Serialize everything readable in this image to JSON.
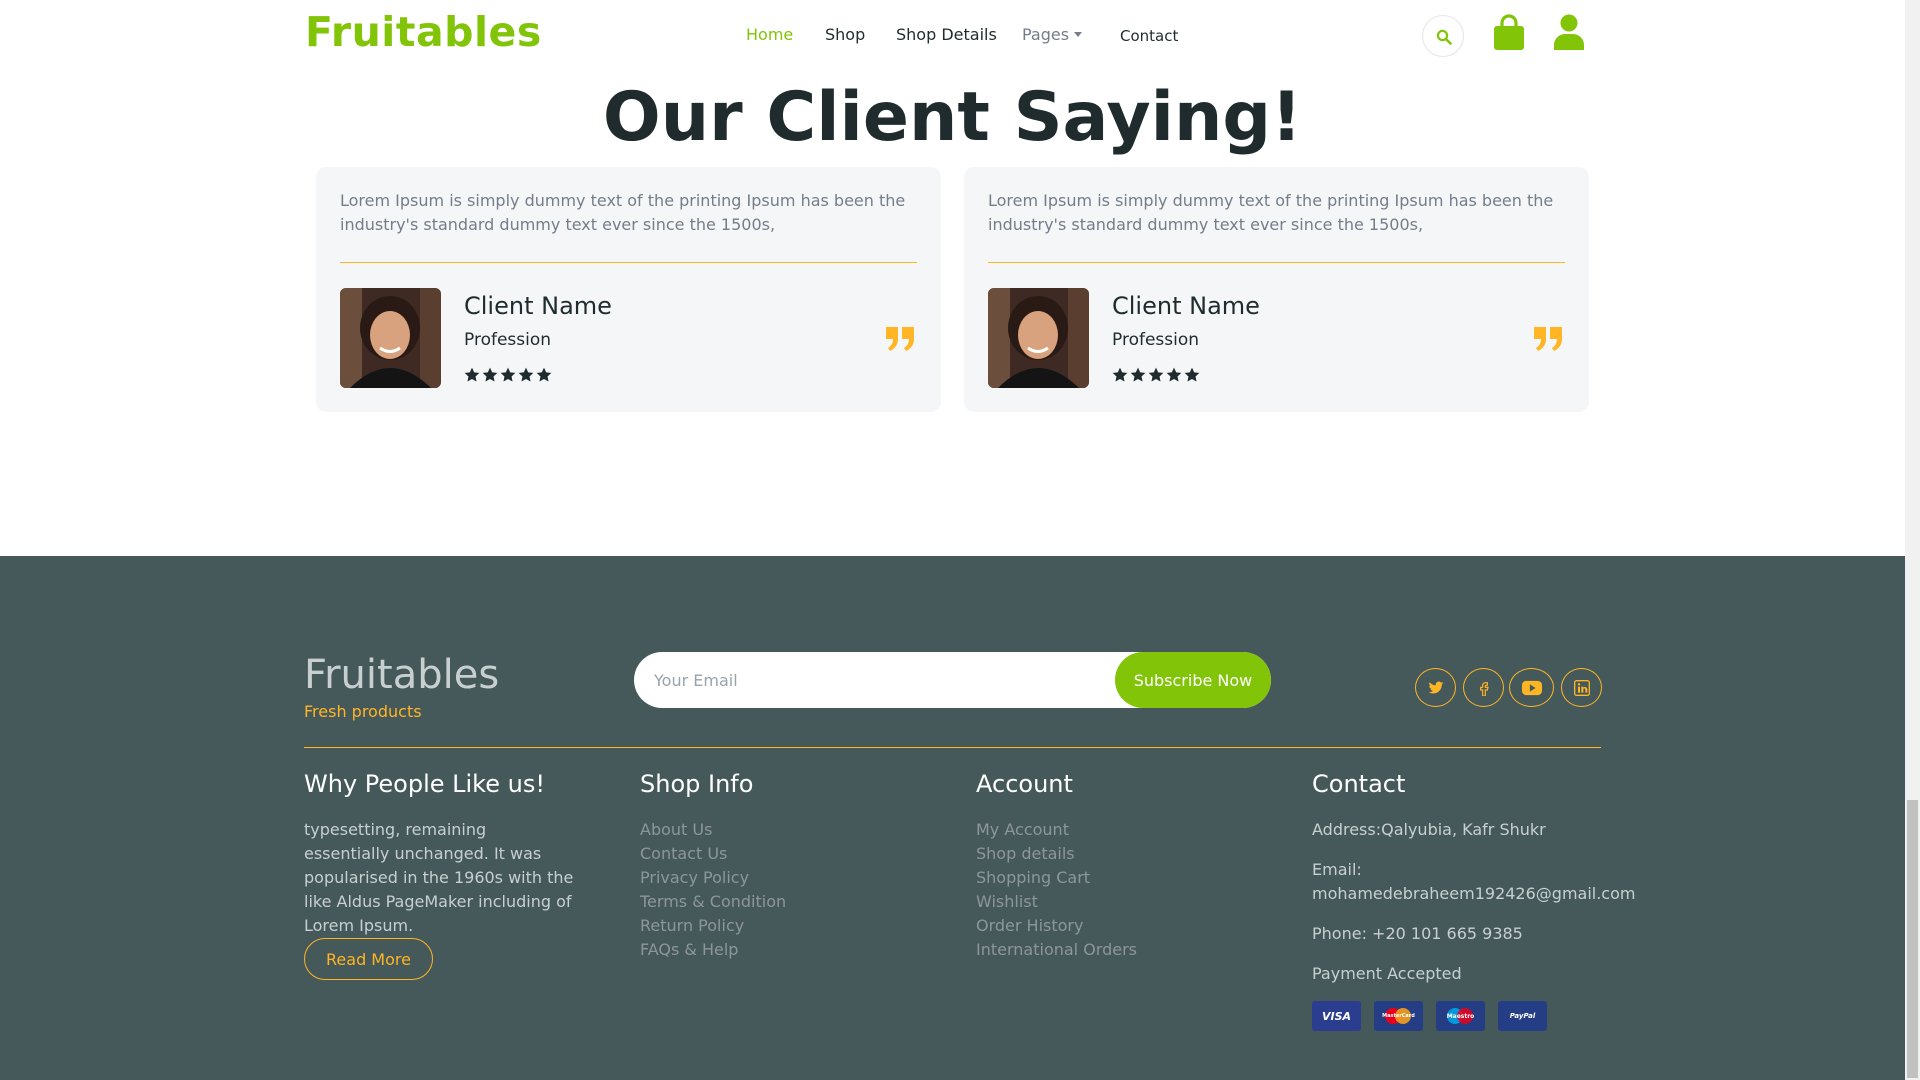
{
  "header": {
    "brand": "Fruitables",
    "nav": {
      "home": "Home",
      "shop": "Shop",
      "shop_details": "Shop Details",
      "pages": "Pages",
      "contact": "Contact"
    },
    "icons": [
      "search-icon",
      "shopping-bag-icon",
      "user-icon"
    ]
  },
  "testimonials": {
    "title": "Our Client Saying!",
    "cards": [
      {
        "text": "Lorem Ipsum is simply dummy text of the printing Ipsum has been the industry's standard dummy text ever since the 1500s,",
        "name": "Client Name",
        "profession": "Profession",
        "rating": 5
      },
      {
        "text": "Lorem Ipsum is simply dummy text of the printing Ipsum has been the industry's standard dummy text ever since the 1500s,",
        "name": "Client Name",
        "profession": "Profession",
        "rating": 5
      }
    ]
  },
  "footer": {
    "brand": "Fruitables",
    "tagline": "Fresh products",
    "email_placeholder": "Your Email",
    "subscribe_label": "Subscribe Now",
    "social_icons": [
      "twitter-icon",
      "facebook-icon",
      "youtube-icon",
      "linkedin-icon"
    ],
    "why": {
      "title": "Why People Like us!",
      "text": "typesetting, remaining essentially unchanged. It was popularised in the 1960s with the like Aldus PageMaker including of Lorem Ipsum.",
      "button": "Read More"
    },
    "shop_info": {
      "title": "Shop Info",
      "links": [
        "About Us",
        "Contact Us",
        "Privacy Policy",
        "Terms & Condition",
        "Return Policy",
        "FAQs & Help"
      ]
    },
    "account": {
      "title": "Account",
      "links": [
        "My Account",
        "Shop details",
        "Shopping Cart",
        "Wishlist",
        "Order History",
        "International Orders"
      ]
    },
    "contact": {
      "title": "Contact",
      "address": "Address:Qalyubia, Kafr Shukr",
      "email_label": "Email:",
      "email": "mohamedebraheem192426@gmail.com",
      "phone": "Phone: +20 101 665 9385",
      "payment": "Payment Accepted",
      "payment_cards": [
        "VISA",
        "MasterCard",
        "Maestro",
        "PayPal"
      ]
    }
  },
  "colors": {
    "primary": "#81c408",
    "secondary": "#ffb524",
    "dark": "#45595b",
    "text_dark": "#1f2b2d",
    "card_bg": "#f4f6f8"
  }
}
